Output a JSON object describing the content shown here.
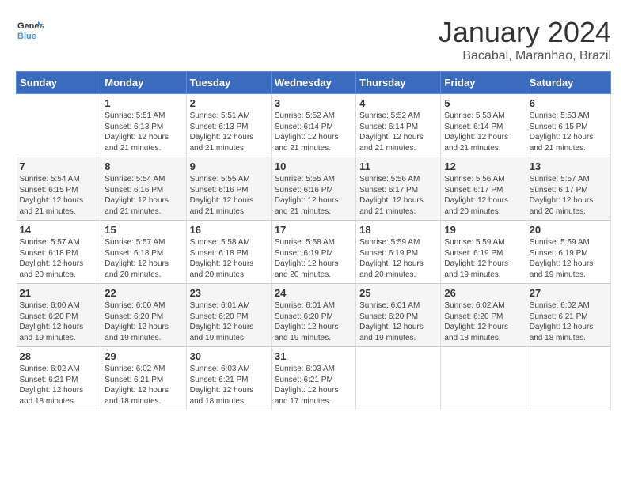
{
  "logo": {
    "line1": "General",
    "line2": "Blue"
  },
  "title": "January 2024",
  "subtitle": "Bacabal, Maranhao, Brazil",
  "days_of_week": [
    "Sunday",
    "Monday",
    "Tuesday",
    "Wednesday",
    "Thursday",
    "Friday",
    "Saturday"
  ],
  "weeks": [
    [
      {
        "day": "",
        "info": ""
      },
      {
        "day": "1",
        "info": "Sunrise: 5:51 AM\nSunset: 6:13 PM\nDaylight: 12 hours\nand 21 minutes."
      },
      {
        "day": "2",
        "info": "Sunrise: 5:51 AM\nSunset: 6:13 PM\nDaylight: 12 hours\nand 21 minutes."
      },
      {
        "day": "3",
        "info": "Sunrise: 5:52 AM\nSunset: 6:14 PM\nDaylight: 12 hours\nand 21 minutes."
      },
      {
        "day": "4",
        "info": "Sunrise: 5:52 AM\nSunset: 6:14 PM\nDaylight: 12 hours\nand 21 minutes."
      },
      {
        "day": "5",
        "info": "Sunrise: 5:53 AM\nSunset: 6:14 PM\nDaylight: 12 hours\nand 21 minutes."
      },
      {
        "day": "6",
        "info": "Sunrise: 5:53 AM\nSunset: 6:15 PM\nDaylight: 12 hours\nand 21 minutes."
      }
    ],
    [
      {
        "day": "7",
        "info": ""
      },
      {
        "day": "8",
        "info": "Sunrise: 5:54 AM\nSunset: 6:16 PM\nDaylight: 12 hours\nand 21 minutes."
      },
      {
        "day": "9",
        "info": "Sunrise: 5:55 AM\nSunset: 6:16 PM\nDaylight: 12 hours\nand 21 minutes."
      },
      {
        "day": "10",
        "info": "Sunrise: 5:55 AM\nSunset: 6:16 PM\nDaylight: 12 hours\nand 21 minutes."
      },
      {
        "day": "11",
        "info": "Sunrise: 5:56 AM\nSunset: 6:17 PM\nDaylight: 12 hours\nand 21 minutes."
      },
      {
        "day": "12",
        "info": "Sunrise: 5:56 AM\nSunset: 6:17 PM\nDaylight: 12 hours\nand 20 minutes."
      },
      {
        "day": "13",
        "info": "Sunrise: 5:57 AM\nSunset: 6:17 PM\nDaylight: 12 hours\nand 20 minutes."
      }
    ],
    [
      {
        "day": "14",
        "info": ""
      },
      {
        "day": "15",
        "info": "Sunrise: 5:57 AM\nSunset: 6:18 PM\nDaylight: 12 hours\nand 20 minutes."
      },
      {
        "day": "16",
        "info": "Sunrise: 5:58 AM\nSunset: 6:18 PM\nDaylight: 12 hours\nand 20 minutes."
      },
      {
        "day": "17",
        "info": "Sunrise: 5:58 AM\nSunset: 6:19 PM\nDaylight: 12 hours\nand 20 minutes."
      },
      {
        "day": "18",
        "info": "Sunrise: 5:59 AM\nSunset: 6:19 PM\nDaylight: 12 hours\nand 20 minutes."
      },
      {
        "day": "19",
        "info": "Sunrise: 5:59 AM\nSunset: 6:19 PM\nDaylight: 12 hours\nand 19 minutes."
      },
      {
        "day": "20",
        "info": "Sunrise: 5:59 AM\nSunset: 6:19 PM\nDaylight: 12 hours\nand 19 minutes."
      }
    ],
    [
      {
        "day": "21",
        "info": ""
      },
      {
        "day": "22",
        "info": "Sunrise: 6:00 AM\nSunset: 6:20 PM\nDaylight: 12 hours\nand 19 minutes."
      },
      {
        "day": "23",
        "info": "Sunrise: 6:01 AM\nSunset: 6:20 PM\nDaylight: 12 hours\nand 19 minutes."
      },
      {
        "day": "24",
        "info": "Sunrise: 6:01 AM\nSunset: 6:20 PM\nDaylight: 12 hours\nand 19 minutes."
      },
      {
        "day": "25",
        "info": "Sunrise: 6:01 AM\nSunset: 6:20 PM\nDaylight: 12 hours\nand 19 minutes."
      },
      {
        "day": "26",
        "info": "Sunrise: 6:02 AM\nSunset: 6:20 PM\nDaylight: 12 hours\nand 18 minutes."
      },
      {
        "day": "27",
        "info": "Sunrise: 6:02 AM\nSunset: 6:21 PM\nDaylight: 12 hours\nand 18 minutes."
      }
    ],
    [
      {
        "day": "28",
        "info": "Sunrise: 6:02 AM\nSunset: 6:21 PM\nDaylight: 12 hours\nand 18 minutes."
      },
      {
        "day": "29",
        "info": "Sunrise: 6:02 AM\nSunset: 6:21 PM\nDaylight: 12 hours\nand 18 minutes."
      },
      {
        "day": "30",
        "info": "Sunrise: 6:03 AM\nSunset: 6:21 PM\nDaylight: 12 hours\nand 18 minutes."
      },
      {
        "day": "31",
        "info": "Sunrise: 6:03 AM\nSunset: 6:21 PM\nDaylight: 12 hours\nand 17 minutes."
      },
      {
        "day": "",
        "info": ""
      },
      {
        "day": "",
        "info": ""
      },
      {
        "day": "",
        "info": ""
      }
    ]
  ],
  "week1_sun_info": "Sunrise: 5:54 AM\nSunset: 6:15 PM\nDaylight: 12 hours\nand 21 minutes.",
  "week3_sun_info": "Sunrise: 5:57 AM\nSunset: 6:18 PM\nDaylight: 12 hours\nand 20 minutes.",
  "week4_sun_info": "Sunrise: 6:00 AM\nSunset: 6:20 PM\nDaylight: 12 hours\nand 19 minutes."
}
